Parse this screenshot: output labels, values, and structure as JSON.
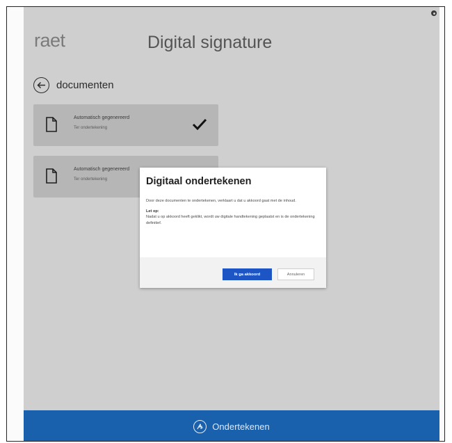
{
  "header": {
    "logo_text": "raet",
    "app_title": "Digital signature"
  },
  "navigation": {
    "back_label": "documenten"
  },
  "documents": [
    {
      "title": "Automatisch gegenereerd",
      "status": "Ter ondertekening",
      "checked": true
    },
    {
      "title": "Automatisch gegenereerd",
      "status": "Ter ondertekening",
      "checked": false
    }
  ],
  "dialog": {
    "title": "Digitaal ondertekenen",
    "body": "Door deze documenten te ondertekenen, verklaart u dat u akkoord gaat met de inhoud.",
    "warning_title": "Let op:",
    "warning_text": "Nadat u op akkoord heeft geklikt, wordt uw digitale handtekening geplaatst en is de ondertekening definitief.",
    "confirm_label": "Ik ga akkoord",
    "cancel_label": "Annuleren"
  },
  "bottom_bar": {
    "sign_label": "Ondertekenen"
  },
  "colors": {
    "accent_blue": "#1a61ad",
    "button_blue": "#1d56c4",
    "overlay_gray": "#cfcfcf"
  },
  "icons": [
    "gear-icon",
    "back-arrow-icon",
    "document-icon",
    "checkmark-icon",
    "signature-icon"
  ]
}
